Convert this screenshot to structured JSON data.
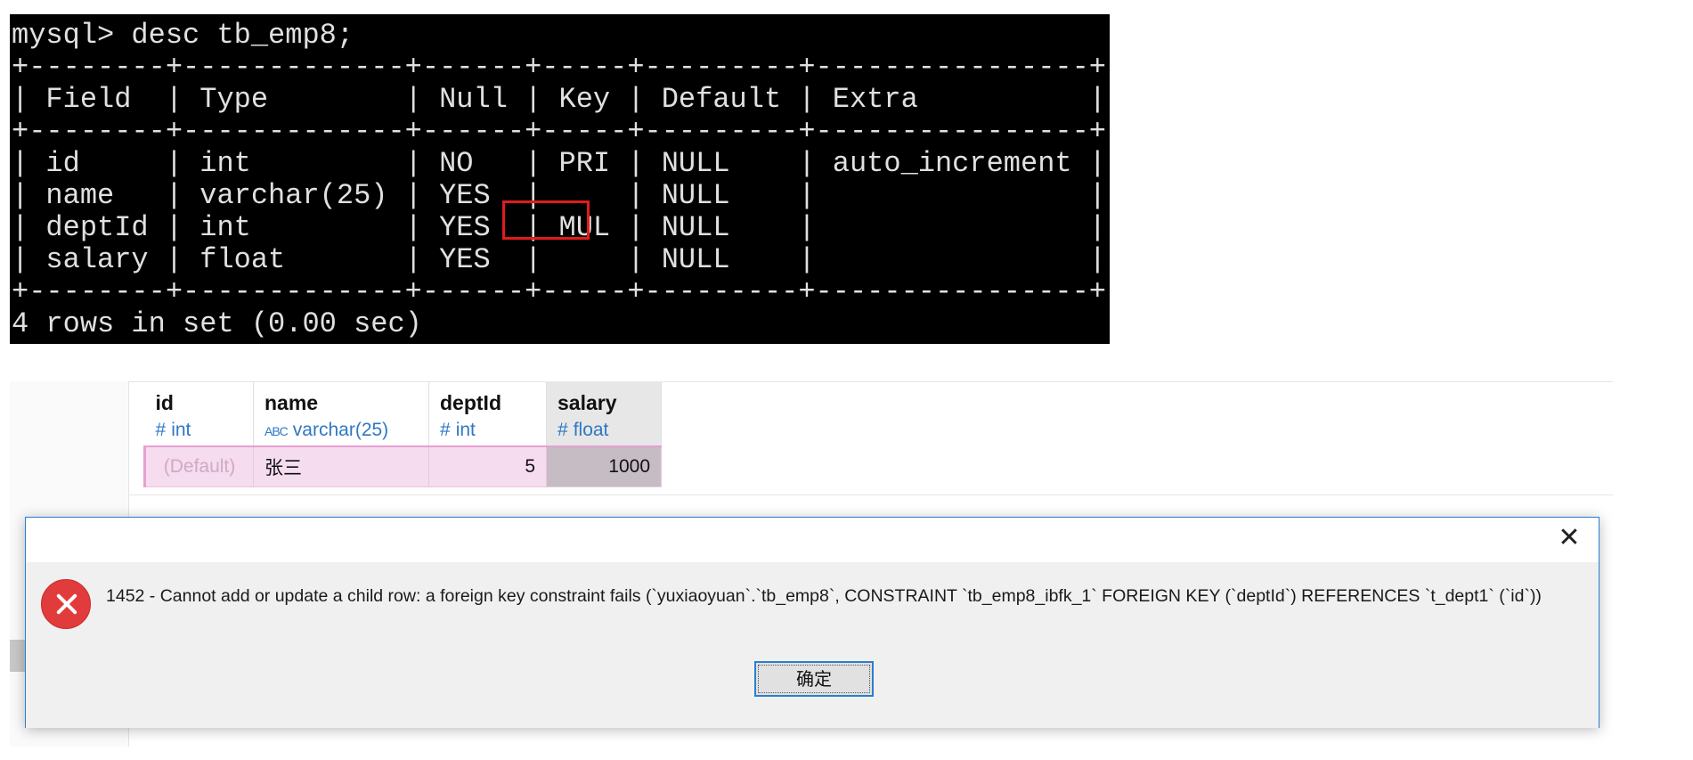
{
  "terminal": {
    "command_line": "mysql> desc tb_emp8;",
    "border_top": "+--------+-------------+------+-----+---------+----------------+",
    "header_line": "| Field  | Type        | Null | Key | Default | Extra          |",
    "border_mid": "+--------+-------------+------+-----+---------+----------------+",
    "rows": [
      "| id     | int         | NO   | PRI | NULL    | auto_increment |",
      "| name   | varchar(25) | YES  |     | NULL    |                |",
      "| deptId | int         | YES  | MUL | NULL    |                |",
      "| salary | float       | YES  |     | NULL    |                |"
    ],
    "border_bottom": "+--------+-------------+------+-----+---------+----------------+",
    "footer_line": "4 rows in set (0.00 sec)",
    "highlight_color": "#e21b1b"
  },
  "grid": {
    "columns": [
      {
        "name": "id",
        "type_icon": "#",
        "type": "int"
      },
      {
        "name": "name",
        "type_icon": "ABC",
        "type": "varchar(25)"
      },
      {
        "name": "deptId",
        "type_icon": "#",
        "type": "int"
      },
      {
        "name": "salary",
        "type_icon": "#",
        "type": "float"
      }
    ],
    "row": {
      "id": "(Default)",
      "name": "张三",
      "deptId": "5",
      "salary": "1000"
    },
    "type_color": "#2f78c4",
    "new_row_color": "#f5dcef"
  },
  "dialog": {
    "close_label": "✕",
    "icon": "error-icon",
    "message": "1452 - Cannot add or update a child row: a foreign key constraint fails (`yuxiaoyuan`.`tb_emp8`, CONSTRAINT `tb_emp8_ibfk_1` FOREIGN KEY (`deptId`) REFERENCES `t_dept1` (`id`))",
    "ok_label": "确定",
    "border_color": "#2a7fd2"
  }
}
